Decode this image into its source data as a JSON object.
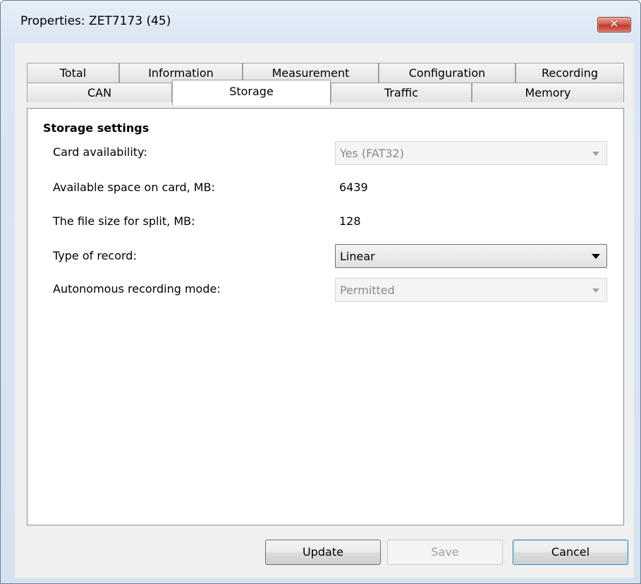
{
  "window": {
    "title": "Properties: ZET7173 (45)",
    "close_label": "✕"
  },
  "tabs": {
    "row1": [
      "Total",
      "Information",
      "Measurement",
      "Configuration",
      "Recording"
    ],
    "row2": [
      "CAN",
      "Storage",
      "Traffic",
      "Memory"
    ],
    "active": "Storage"
  },
  "storage": {
    "heading": "Storage settings",
    "card_availability": {
      "label": "Card availability:",
      "value": "Yes (FAT32)"
    },
    "available_space": {
      "label": "Available space on card, MB:",
      "value": "6439"
    },
    "split_size": {
      "label": "The file size for split, MB:",
      "value": "128"
    },
    "record_type": {
      "label": "Type of record:",
      "value": "Linear"
    },
    "autonomous_mode": {
      "label": "Autonomous recording mode:",
      "value": "Permitted"
    }
  },
  "buttons": {
    "update": "Update",
    "save": "Save",
    "cancel": "Cancel"
  }
}
